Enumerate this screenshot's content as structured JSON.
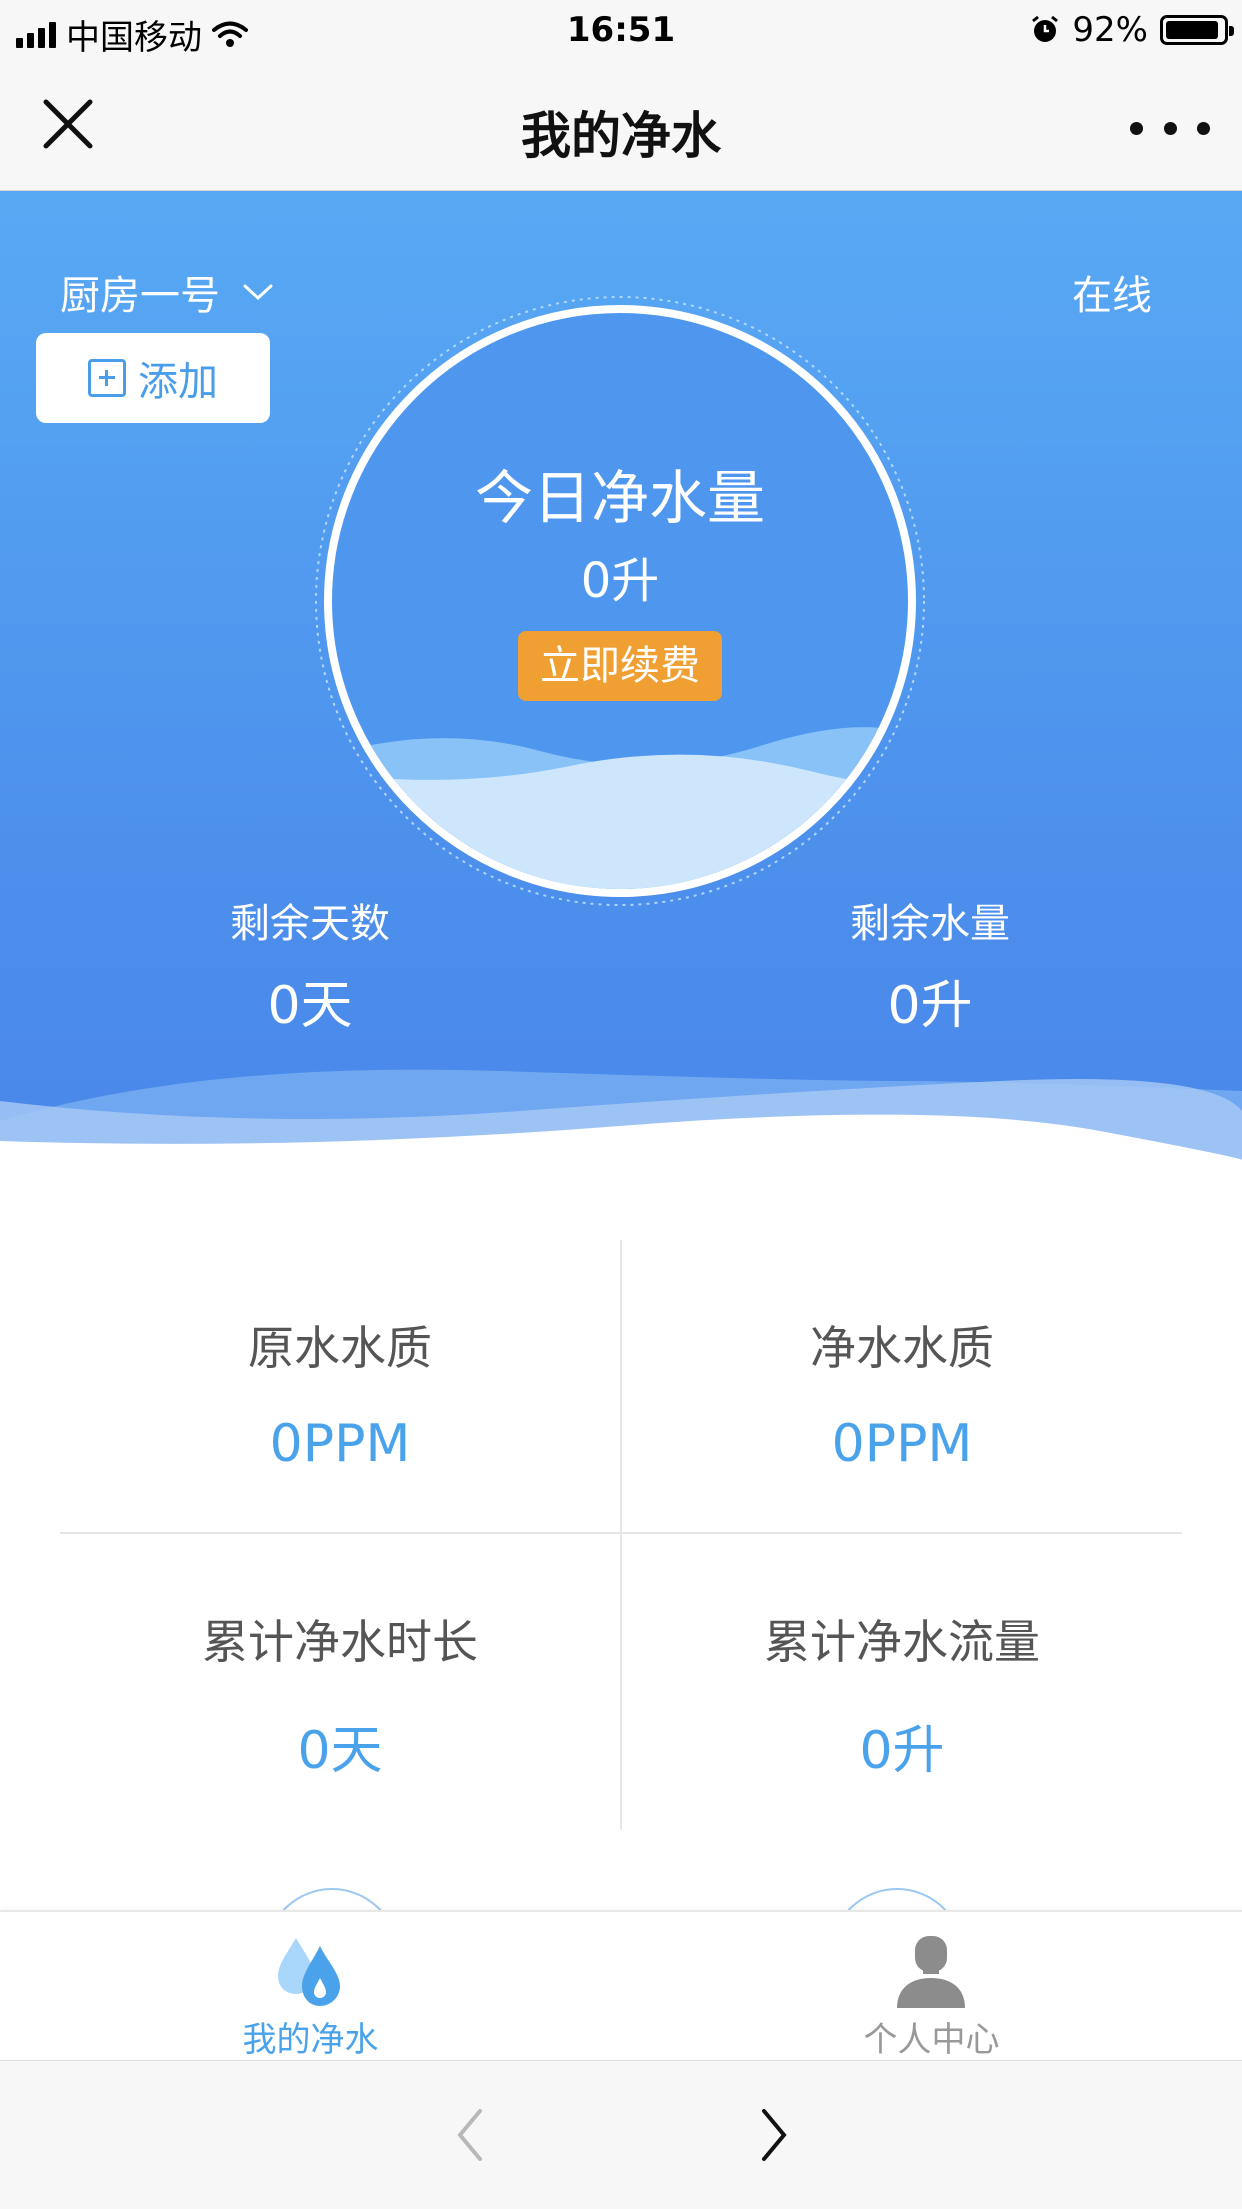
{
  "status_bar": {
    "carrier": "中国移动",
    "time": "16:51",
    "battery_percent": "92%",
    "battery_level": 0.92
  },
  "nav": {
    "title": "我的净水"
  },
  "hero": {
    "device_name": "厨房一号",
    "status": "在线",
    "add_label": "添加",
    "gauge_label": "今日净水量",
    "gauge_value": "0升",
    "renew_label": "立即续费",
    "remaining_days_label": "剩余天数",
    "remaining_days_value": "0天",
    "remaining_water_label": "剩余水量",
    "remaining_water_value": "0升"
  },
  "stats": [
    {
      "label": "原水水质",
      "value": "0PPM"
    },
    {
      "label": "净水水质",
      "value": "0PPM"
    },
    {
      "label": "累计净水时长",
      "value": "0天"
    },
    {
      "label": "累计净水流量",
      "value": "0升"
    }
  ],
  "tabs": [
    {
      "label": "我的净水",
      "icon": "water-drops-icon",
      "active": true
    },
    {
      "label": "个人中心",
      "icon": "user-avatar-icon",
      "active": false
    }
  ],
  "colors": {
    "accent": "#4aa3ea",
    "hero_top": "#58a9f4",
    "hero_bottom": "#4a87ea",
    "renew": "#f0a032",
    "inactive_tab": "#999999"
  }
}
